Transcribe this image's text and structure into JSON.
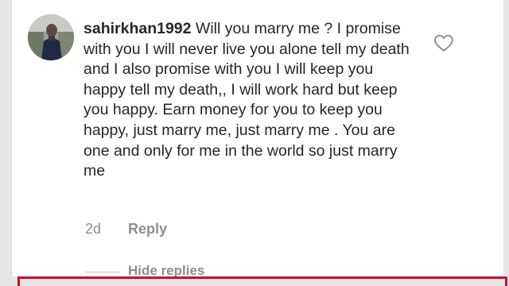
{
  "comment": {
    "username": "sahirkhan1992",
    "text": " Will you marry me ? I promise with you I will never live you alone tell my death and I also promise with you I will keep you happy tell my death,, I will work hard but keep you happy. Earn money for you to keep you happy, just marry me, just marry me . You are one and only for me in the world so just marry me",
    "age": "2d",
    "reply_label": "Reply",
    "hide_replies_label": "Hide replies"
  },
  "icons": {
    "like": "heart-outline-icon",
    "avatar": "profile-photo"
  },
  "colors": {
    "text": "#262626",
    "muted": "#8e8e8e",
    "highlight_box": "#c8102e"
  }
}
